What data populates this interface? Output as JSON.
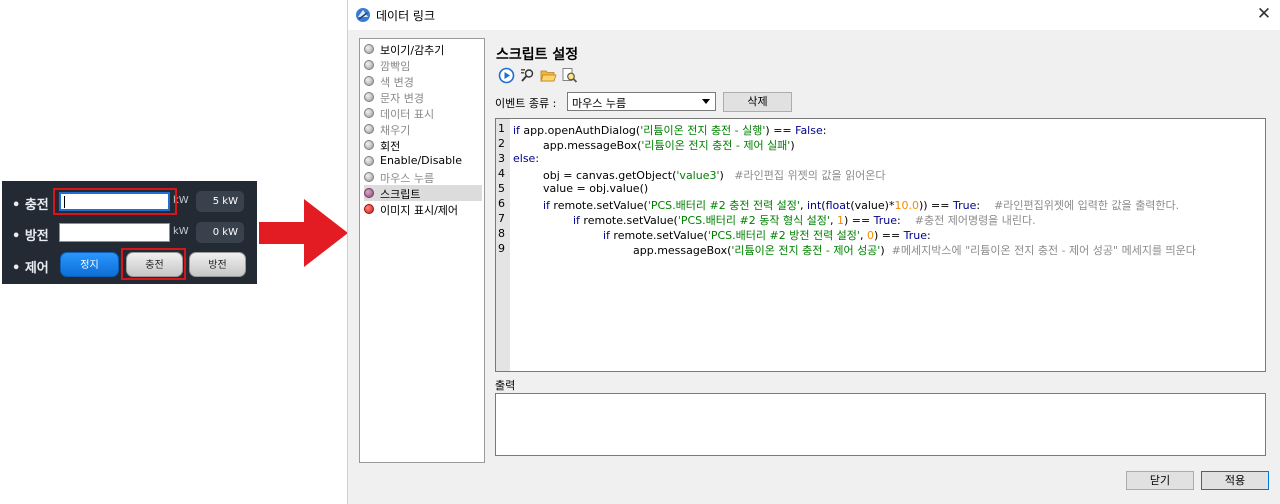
{
  "control_panel": {
    "rows": [
      {
        "label": "• 충전",
        "unit": "kW",
        "value": "5 kW"
      },
      {
        "label": "• 방전",
        "unit": "kW",
        "value": "0 kW"
      },
      {
        "label": "• 제어"
      }
    ],
    "buttons": {
      "stop": "정지",
      "charge": "충전",
      "discharge": "방전"
    },
    "colors": {
      "highlight": "#d8151b",
      "panel": "#232a33",
      "stop_button": "#1a86f0"
    }
  },
  "arrow": {
    "color": "#e31b23"
  },
  "dialog": {
    "title": "데이터 링크",
    "close_glyph": "✕",
    "tree_items": [
      {
        "label": "보이기/감추기",
        "dot": "grey",
        "disabled": false,
        "selected": false
      },
      {
        "label": "깜빡임",
        "dot": "grey",
        "disabled": true,
        "selected": false
      },
      {
        "label": "색 변경",
        "dot": "grey",
        "disabled": true,
        "selected": false
      },
      {
        "label": "문자 변경",
        "dot": "grey",
        "disabled": true,
        "selected": false
      },
      {
        "label": "데이터 표시",
        "dot": "grey",
        "disabled": true,
        "selected": false
      },
      {
        "label": "채우기",
        "dot": "grey",
        "disabled": true,
        "selected": false
      },
      {
        "label": "회전",
        "dot": "grey",
        "disabled": false,
        "selected": false
      },
      {
        "label": "Enable/Disable",
        "dot": "grey",
        "disabled": false,
        "selected": false
      },
      {
        "label": "마우스 누름",
        "dot": "grey",
        "disabled": true,
        "selected": false
      },
      {
        "label": "스크립트",
        "dot": "purple",
        "disabled": false,
        "selected": true
      },
      {
        "label": "이미지 표시/제어",
        "dot": "red",
        "disabled": false,
        "selected": false
      }
    ],
    "section_title": "스크립트 설정",
    "toolbar_icons": [
      "run-icon",
      "find-icon",
      "open-folder-icon",
      "inspect-icon"
    ],
    "event_label": "이벤트 종류 :",
    "event_selected": "마우스 누름",
    "delete_button": "삭제",
    "code_lines": [
      {
        "num": "1",
        "text": "if app.openAuthDialog('리튬이온 전지 충전 - 실행') == False:"
      },
      {
        "num": "2",
        "text": "app.messageBox('리튬이온 전지 충전 - 제어 실패')"
      },
      {
        "num": "3",
        "text": "else:"
      },
      {
        "num": "4",
        "text": "obj = canvas.getObject('value3')   #라인편집 위젯의 값을 읽어온다"
      },
      {
        "num": "5",
        "text": "value = obj.value()"
      },
      {
        "num": "6",
        "text": "if remote.setValue('PCS.배터리 #2 충전 전력 설정', int(float(value)*10.0)) == True:    #라인편집위젯에 입력한 값을 출력한다."
      },
      {
        "num": "7",
        "text": "if remote.setValue('PCS.배터리 #2 동작 형식 설정', 1) == True:    #충전 제어명령을 내린다."
      },
      {
        "num": "8",
        "text": "if remote.setValue('PCS.배터리 #2 방전 전력 설정', 0) == True:"
      },
      {
        "num": "9",
        "text": "app.messageBox('리튬이온 전지 충전 - 제어 성공')  #메세지박스에 \"리튬이온 전지 충전 - 제어 성공\" 메세지를 띄운다"
      }
    ],
    "output_label": "출력",
    "close_button": "닫기",
    "apply_button": "적용"
  }
}
